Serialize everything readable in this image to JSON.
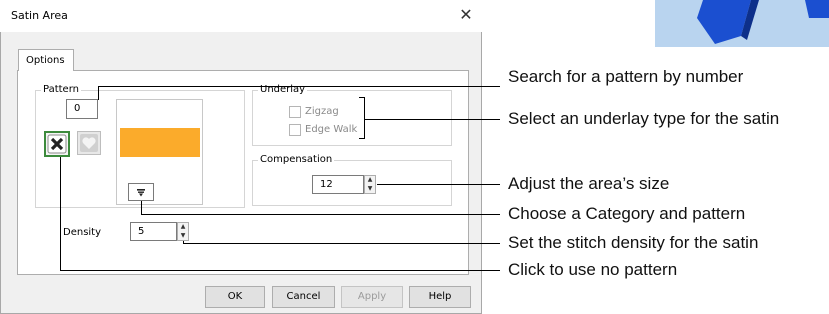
{
  "dialog": {
    "title": "Satin Area",
    "close_glyph": "✕",
    "tab_label": "Options",
    "pattern": {
      "legend": "Pattern",
      "number_value": "0",
      "swatch_color": "#fbab2b",
      "no_pattern_icon": "x-mark-icon",
      "heart_icon": "heart-icon",
      "category_icon": "funnel-icon"
    },
    "underlay": {
      "legend": "Underlay",
      "zigzag_label": "Zigzag",
      "edgewalk_label": "Edge Walk"
    },
    "compensation": {
      "legend": "Compensation",
      "value": "12"
    },
    "density": {
      "label": "Density",
      "value": "5"
    },
    "buttons": {
      "ok": "OK",
      "cancel": "Cancel",
      "apply": "Apply",
      "help": "Help"
    }
  },
  "callouts": {
    "search": "Search for a pattern by number",
    "underlay": "Select an underlay type for the satin",
    "size": "Adjust the area’s size",
    "category": "Choose a Category and pattern",
    "density": "Set the stitch density for the satin",
    "no_pattern": "Click to use no pattern"
  },
  "colors": {
    "accent_blue": "#1a4fc0",
    "swatch": "#fbab2b"
  }
}
